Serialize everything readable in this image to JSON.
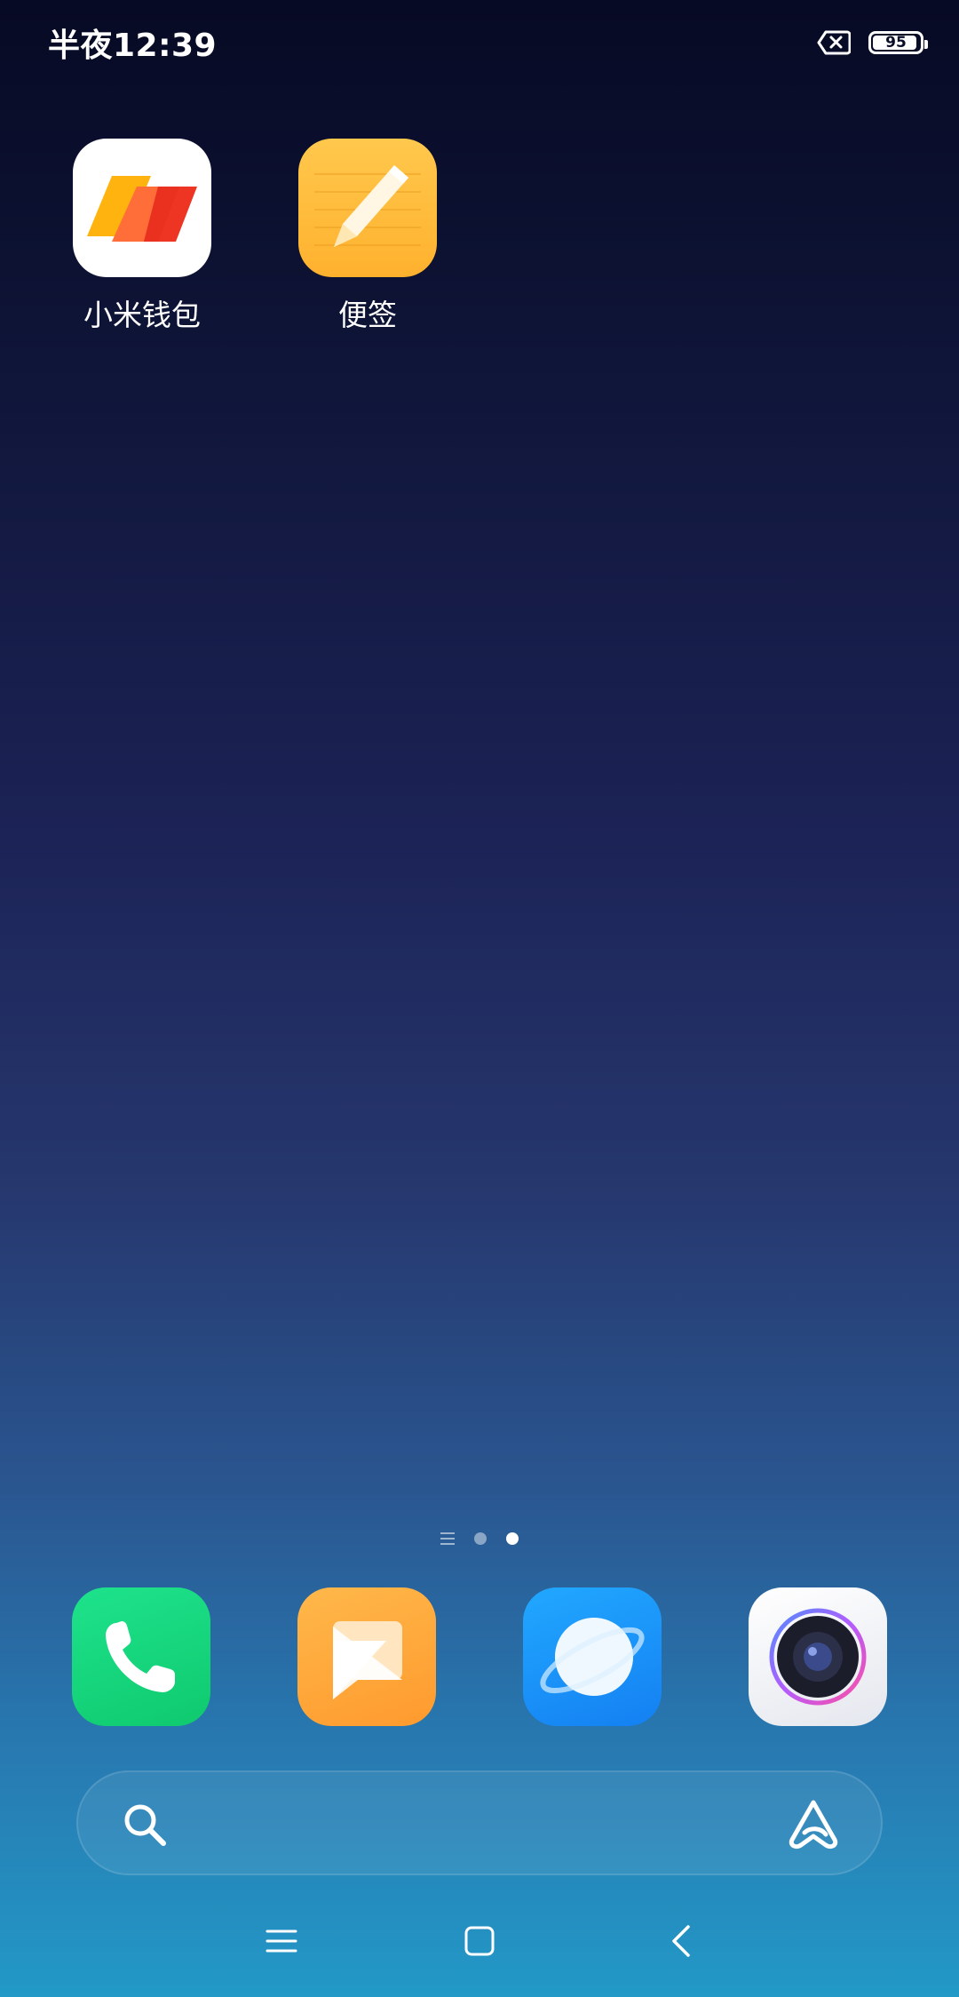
{
  "status_bar": {
    "time": "半夜12:39",
    "battery_level": 95,
    "battery_text": "95",
    "sim_icon": "no-sim-icon"
  },
  "home_apps": [
    {
      "label": "小米钱包",
      "icon": "wallet-icon"
    },
    {
      "label": "便签",
      "icon": "notes-pencil-icon"
    }
  ],
  "page_indicator": {
    "pages": 2,
    "active_page": 2,
    "has_feed_page": true
  },
  "dock": [
    {
      "icon": "phone-icon",
      "color": "#12d27a"
    },
    {
      "icon": "messages-icon",
      "color": "#ffa738"
    },
    {
      "icon": "browser-icon",
      "color": "#1a95fb"
    },
    {
      "icon": "camera-icon",
      "color": "#eef0f4"
    }
  ],
  "search_bar": {
    "left_icon": "search-icon",
    "right_icon": "assistant-icon"
  },
  "nav_bar": {
    "buttons": [
      "menu-icon",
      "home-icon",
      "back-icon"
    ]
  }
}
